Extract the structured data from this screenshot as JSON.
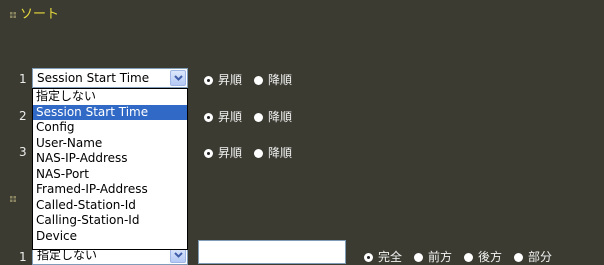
{
  "sort_section": {
    "title": "ソート",
    "rows": [
      {
        "number": "1",
        "select_value": "Session Start Time",
        "asc_label": "昇順",
        "desc_label": "降順"
      },
      {
        "number": "2",
        "asc_label": "昇順",
        "desc_label": "降順"
      },
      {
        "number": "3",
        "asc_label": "昇順",
        "desc_label": "降順"
      }
    ],
    "dropdown_options": [
      "指定しない",
      "Session Start Time",
      "Config",
      "User-Name",
      "NAS-IP-Address",
      "NAS-Port",
      "Framed-IP-Address",
      "Called-Station-Id",
      "Calling-Station-Id",
      "Device"
    ],
    "dropdown_selected": "Session Start Time"
  },
  "filter_section": {
    "row_number": "1",
    "select_value": "指定しない",
    "match_options": [
      "完全",
      "前方",
      "後方",
      "部分"
    ]
  }
}
